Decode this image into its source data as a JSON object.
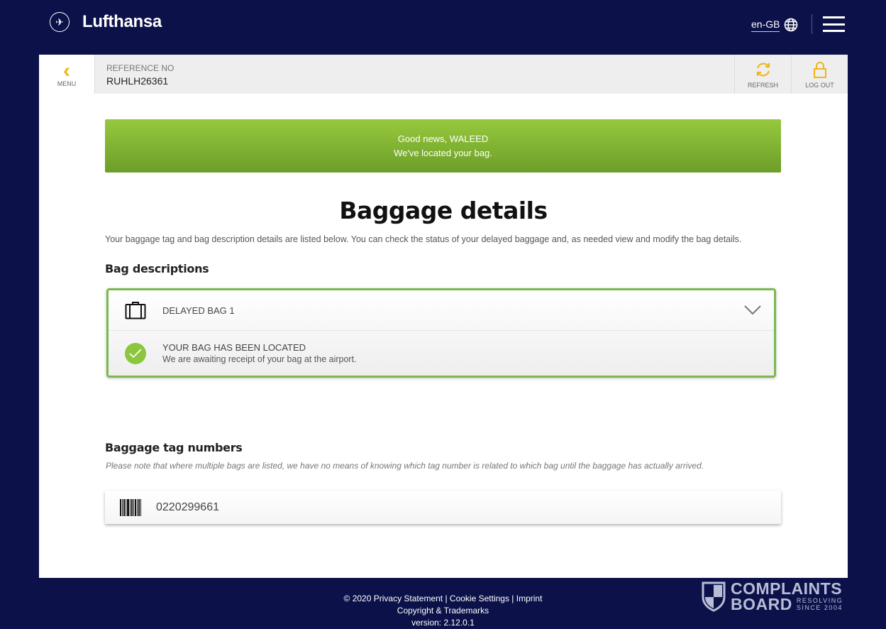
{
  "header": {
    "brand": "Lufthansa",
    "language": "en-GB"
  },
  "topbar": {
    "menu_label": "MENU",
    "reference_label": "REFERENCE NO",
    "reference_value": "RUHLH26361",
    "refresh_label": "REFRESH",
    "logout_label": "LOG OUT"
  },
  "banner": {
    "line1": "Good news, WALEED",
    "line2": "We've located your bag.",
    "color": "#8cc63e"
  },
  "main": {
    "title": "Baggage details",
    "intro": "Your baggage tag and bag description details are listed below. You can check the status of your delayed baggage and, as needed view and modify the bag details.",
    "bag_descriptions_heading": "Bag descriptions",
    "bags": [
      {
        "name": "DELAYED BAG 1",
        "status_title": "YOUR BAG HAS BEEN LOCATED",
        "status_text": "We are awaiting receipt of your bag at the airport."
      }
    ],
    "tag_heading": "Baggage tag numbers",
    "tag_note": "Please note that where multiple bags are listed, we have no means of knowing which tag number is related to which bag until the baggage has actually arrived.",
    "tags": [
      "0220299661"
    ]
  },
  "footer": {
    "copyright": "© 2020",
    "privacy": "Privacy Statement",
    "cookie": "Cookie Settings",
    "imprint": "Imprint",
    "trademarks": "Copyright & Trademarks",
    "version": "version: 2.12.0.1"
  },
  "watermark": {
    "line1": "COMPLAINTS",
    "line2": "BOARD",
    "tag1": "RESOLVING",
    "tag2": "SINCE 2004"
  },
  "colors": {
    "background": "#0c1249",
    "accent": "#f0b51b",
    "success": "#7cb84f"
  }
}
